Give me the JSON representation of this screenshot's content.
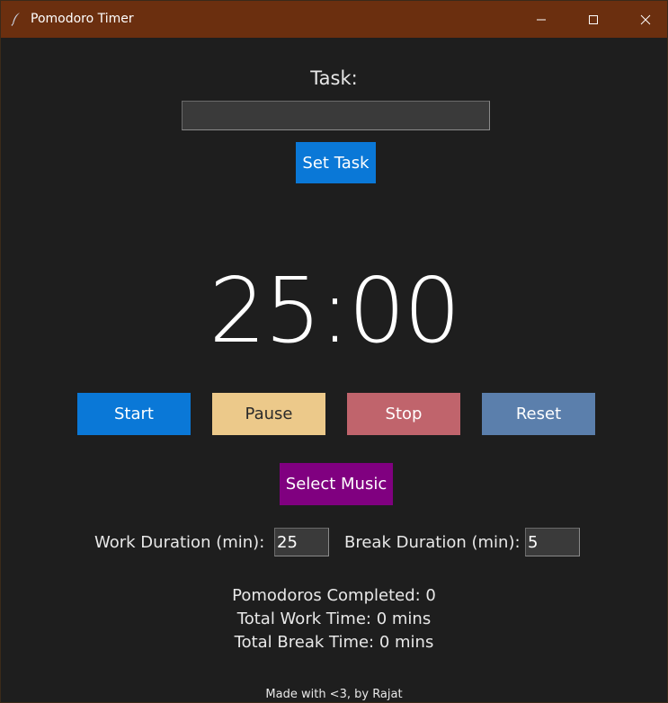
{
  "window": {
    "title": "Pomodoro Timer",
    "titlebar_color": "#6b2f0f",
    "icon": "feather-icon"
  },
  "task": {
    "label": "Task:",
    "value": "",
    "set_button": "Set Task"
  },
  "timer": {
    "display": "25:00"
  },
  "controls": {
    "start": "Start",
    "pause": "Pause",
    "stop": "Stop",
    "reset": "Reset",
    "select_music": "Select Music",
    "colors": {
      "start": "#0a78d7",
      "pause": "#ecc98a",
      "stop": "#c0646c",
      "reset": "#5b7fac",
      "select_music": "#800080"
    }
  },
  "settings": {
    "work_label": "Work Duration (min):",
    "work_value": "25",
    "break_label": "Break Duration (min):",
    "break_value": "5"
  },
  "stats": {
    "pomodoros": "Pomodoros Completed: 0",
    "work_time": "Total Work Time: 0 mins",
    "break_time": "Total Break Time: 0 mins"
  },
  "footer": {
    "text": "Made with <3, by Rajat"
  }
}
